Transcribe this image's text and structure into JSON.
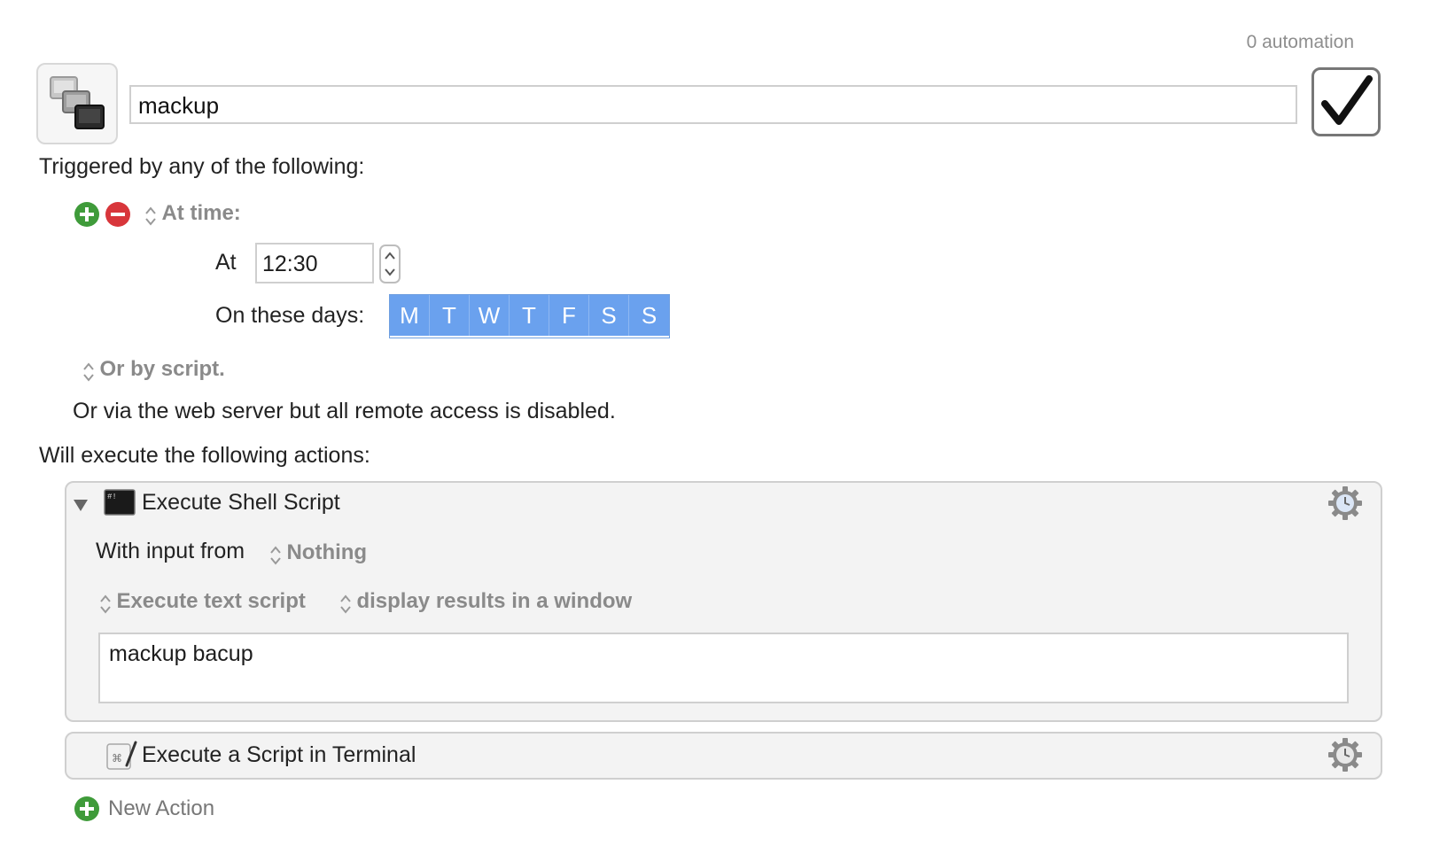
{
  "header": {
    "automation_count": "0 automation",
    "macro_name": "mackup",
    "enabled": true,
    "macro_icon": "macro-windows-icon",
    "enabled_icon": "checkmark-icon"
  },
  "triggers": {
    "heading": "Triggered by any of the following:",
    "add_icon": "plus-circle-icon",
    "remove_icon": "minus-circle-icon",
    "trigger_type": "At time:",
    "at_label": "At",
    "time_value": "12:30",
    "days_label": "On these days:",
    "days": [
      "M",
      "T",
      "W",
      "T",
      "F",
      "S",
      "S"
    ],
    "script_trigger": "Or by script.",
    "web_server_note": "Or via the web server but all remote access is disabled."
  },
  "actions": {
    "heading": "Will execute the following actions:",
    "items": [
      {
        "title": "Execute Shell Script",
        "icon": "terminal-icon",
        "input_label": "With input from",
        "input_value": "Nothing",
        "mode": "Execute text script",
        "output": "display results in a window",
        "script": "mackup bacup"
      },
      {
        "title": "Execute a Script in Terminal",
        "icon": "script-editor-icon"
      }
    ],
    "new_action_label": "New Action"
  },
  "colors": {
    "day_selected": "#6aa1ee",
    "add_green": "#3f9b3a",
    "remove_red": "#d8363b"
  }
}
